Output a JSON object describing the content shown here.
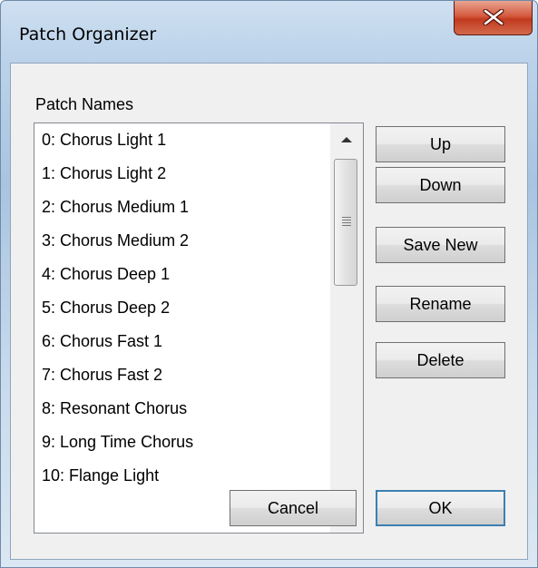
{
  "window": {
    "title": "Patch Organizer",
    "close_label": "X"
  },
  "patch_list": {
    "label": "Patch Names",
    "items": [
      "0: Chorus Light 1",
      "1: Chorus Light 2",
      "2: Chorus Medium 1",
      "3: Chorus Medium 2",
      "4: Chorus Deep 1",
      "5: Chorus Deep 2",
      "6: Chorus Fast 1",
      "7: Chorus Fast 2",
      "8: Resonant Chorus",
      "9: Long Time Chorus",
      "10: Flange Light"
    ]
  },
  "buttons": {
    "up": "Up",
    "down": "Down",
    "save_new": "Save New",
    "rename": "Rename",
    "delete": "Delete",
    "cancel": "Cancel",
    "ok": "OK"
  },
  "icons": {
    "close": "close-icon",
    "scroll_up": "scroll-up-arrow-icon",
    "scroll_down": "scroll-down-arrow-icon",
    "thumb_grip": "grip-icon"
  },
  "colors": {
    "close_button": "#c8432a",
    "default_button_border": "#3c7fb1"
  }
}
